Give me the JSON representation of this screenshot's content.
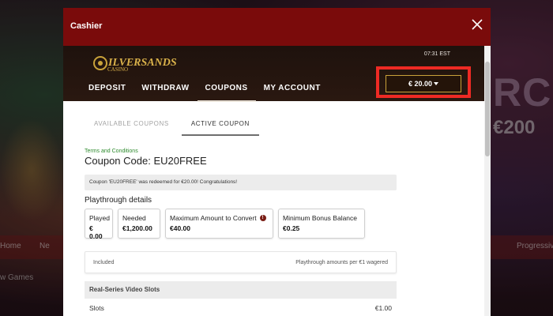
{
  "background": {
    "promo_text": "RCHI",
    "promo_amount": "€200",
    "nav_items": [
      "Home",
      "Ne",
      "Progressiv"
    ],
    "games_label": "w Games"
  },
  "modal": {
    "title": "Cashier",
    "close_icon": "close-icon",
    "header_color": "#7a0b0b"
  },
  "cashier": {
    "logo_text": "ILVERSANDS",
    "logo_sub": "CASINO",
    "clock": "07:31 EST",
    "nav": [
      "DEPOSIT",
      "WITHDRAW",
      "COUPONS",
      "MY ACCOUNT"
    ],
    "active_nav": "COUPONS",
    "balance": "€ 20.00",
    "balance_icon": "caret-down-icon"
  },
  "coupons": {
    "subtabs": [
      "AVAILABLE COUPONS",
      "ACTIVE COUPON"
    ],
    "active_subtab": "ACTIVE COUPON",
    "terms_link": "Terms and Conditions",
    "coupon_code_title": "Coupon Code: EU20FREE",
    "redeemed_message": "Coupon 'EU20FREE' was redeemed for €20.00! Congratulations!",
    "playthrough_label": "Playthrough details",
    "cards": [
      {
        "label": "Played",
        "value": "€ 0.00"
      },
      {
        "label": "Needed",
        "value": "€1,200.00"
      },
      {
        "label": "Maximum Amount to Convert",
        "value": "€40.00",
        "info_icon": "info-icon"
      },
      {
        "label": "Minimum Bonus Balance",
        "value": "€0.25"
      }
    ],
    "table_header": {
      "left": "Included",
      "right": "Playthrough amounts per €1 wagered"
    },
    "section": "Real-Series Video Slots",
    "rows": [
      {
        "name": "Slots",
        "value": "€1.00"
      }
    ]
  }
}
